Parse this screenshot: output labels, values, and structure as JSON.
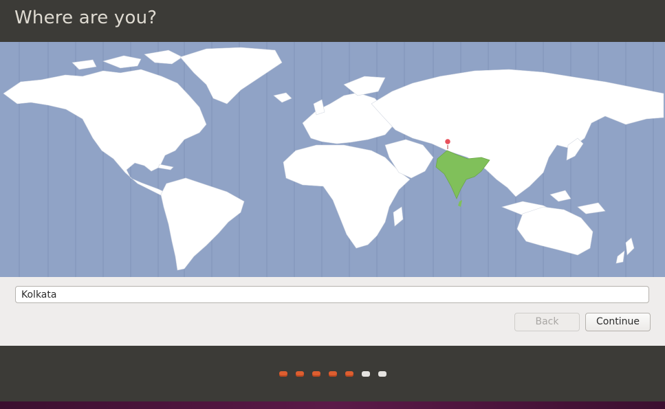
{
  "window": {
    "title": "Where are you?"
  },
  "map": {
    "selected_region": "India",
    "marker_icon": "location-pin-icon",
    "colors": {
      "ocean": "#90a3c6",
      "land": "#ffffff",
      "selected_land": "#80c05a",
      "marker": "#e8505b",
      "timezone_lines": "#7f93b8"
    }
  },
  "location": {
    "value": "Kolkata",
    "placeholder": ""
  },
  "buttons": {
    "back_label": "Back",
    "continue_label": "Continue"
  },
  "progress": {
    "total_steps": 7,
    "completed_steps": 5,
    "colors": {
      "done": "#dd5e30",
      "pending": "#e5e3e0"
    }
  }
}
